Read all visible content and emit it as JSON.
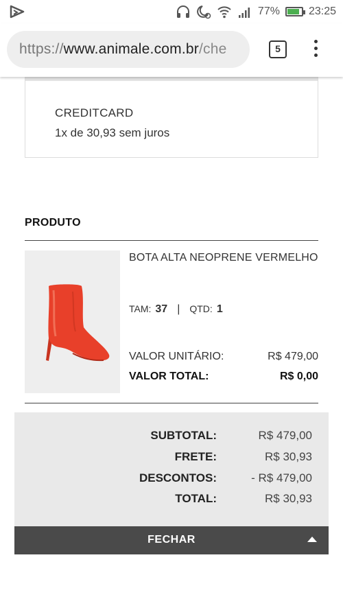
{
  "statusbar": {
    "battery_percent": "77%",
    "battery_level": 0.77,
    "time": "23:25",
    "icons": [
      "headphones-icon",
      "moon-alarm-icon",
      "wifi-icon",
      "signal-icon",
      "battery-icon"
    ]
  },
  "browser": {
    "url_protocol": "https://",
    "url_host": "www.animale.com.br",
    "url_rest": "/che",
    "tab_count": "5"
  },
  "payment": {
    "method": "CREDITCARD",
    "installments": "1x de 30,93 sem juros"
  },
  "product_section": {
    "title": "PRODUTO",
    "item": {
      "name": "BOTA ALTA NEOPRENE VERMELHO",
      "size_label": "TAM:",
      "size_value": "37",
      "separator": "|",
      "qty_label": "QTD:",
      "qty_value": "1",
      "unit_label": "VALOR UNITÁRIO:",
      "unit_value": "R$ 479,00",
      "total_label": "VALOR TOTAL:",
      "total_value": "R$ 0,00"
    }
  },
  "summary": {
    "subtotal_label": "SUBTOTAL:",
    "subtotal_value": "R$ 479,00",
    "shipping_label": "FRETE:",
    "shipping_value": "R$ 30,93",
    "discount_label": "DESCONTOS:",
    "discount_value": "- R$ 479,00",
    "total_label": "TOTAL:",
    "total_value": "R$ 30,93"
  },
  "footer": {
    "close_label": "FECHAR"
  },
  "colors": {
    "boot_red": "#e8402a",
    "summary_bg": "#e9e9e9",
    "close_bar_bg": "#4a4a4a",
    "battery_green": "#4caf50"
  }
}
